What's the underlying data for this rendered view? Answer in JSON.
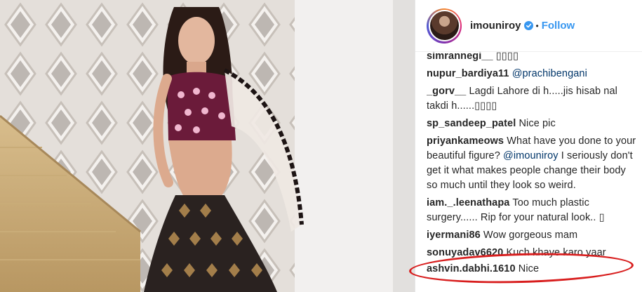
{
  "post": {
    "username": "imouniroy",
    "dot": "•",
    "follow_label": "Follow",
    "accent_color": "#3897f0",
    "annotation_color": "#d81e1e"
  },
  "comments": [
    {
      "user": "simrannegi__",
      "text": "▯▯▯▯"
    },
    {
      "user": "nupur_bardiya11",
      "mention": "@prachibengani",
      "text": ""
    },
    {
      "user": "_gorv__",
      "text": "Lagdi Lahore di h.....jis hisab nal takdi h......▯▯▯▯"
    },
    {
      "user": "sp_sandeep_patel",
      "text": "Nice pic"
    },
    {
      "user": "priyankameows",
      "text": "What have you done to your beautiful figure?",
      "mention": "@imouniroy",
      "text2": "I seriously don't get it what makes people change their body so much until they look so weird."
    },
    {
      "user": "iam._.leenathapa",
      "text": "Too much plastic surgery...... Rip for your natural look.. ▯"
    },
    {
      "user": "iyermani86",
      "text": "Wow gorgeous mam"
    },
    {
      "user": "sonuyadav6620",
      "text": "Kuch khaye karo yaar"
    },
    {
      "user": "ashvin.dabhi.1610",
      "text": "Nice"
    }
  ]
}
